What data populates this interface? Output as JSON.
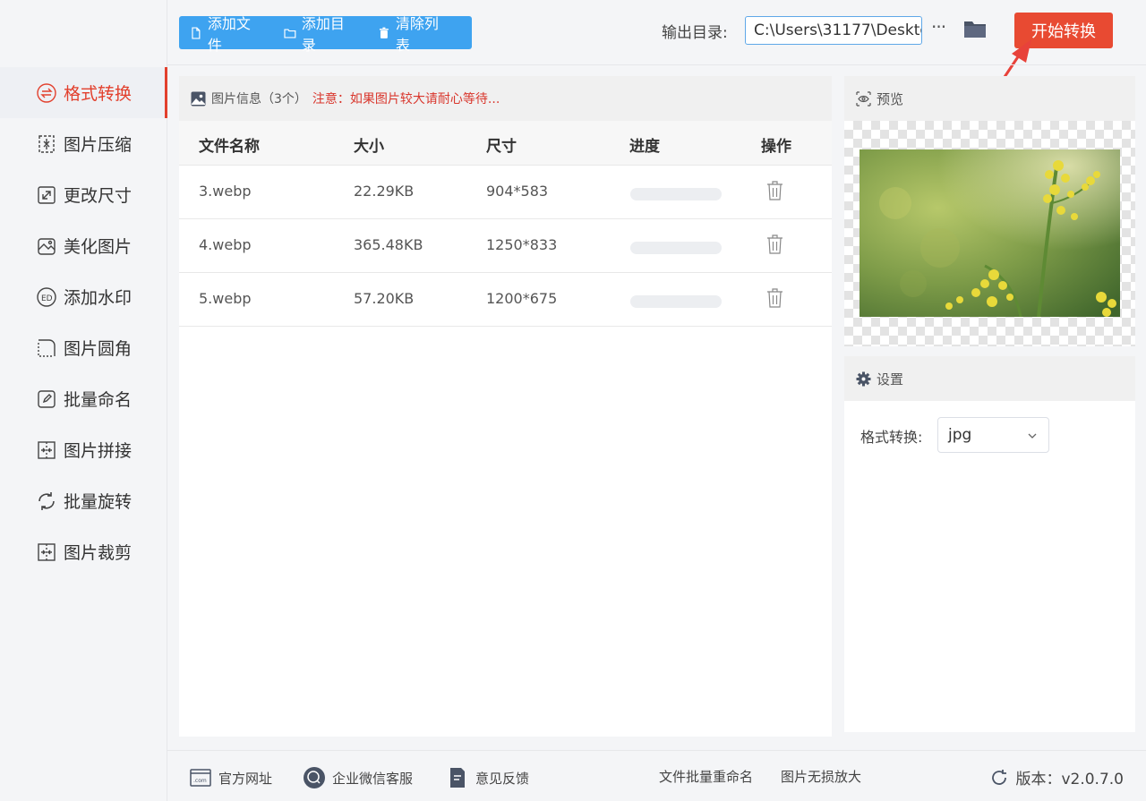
{
  "sidebar": {
    "items": [
      {
        "label": "格式转换",
        "icon": "swap-circle-icon",
        "active": true
      },
      {
        "label": "图片压缩",
        "icon": "compress-icon",
        "active": false
      },
      {
        "label": "更改尺寸",
        "icon": "resize-icon",
        "active": false
      },
      {
        "label": "美化图片",
        "icon": "beautify-icon",
        "active": false
      },
      {
        "label": "添加水印",
        "icon": "watermark-icon",
        "active": false
      },
      {
        "label": "图片圆角",
        "icon": "round-corner-icon",
        "active": false
      },
      {
        "label": "批量命名",
        "icon": "rename-icon",
        "active": false
      },
      {
        "label": "图片拼接",
        "icon": "merge-icon",
        "active": false
      },
      {
        "label": "批量旋转",
        "icon": "rotate-icon",
        "active": false
      },
      {
        "label": "图片裁剪",
        "icon": "crop-icon",
        "active": false
      }
    ]
  },
  "toolbar": {
    "add_file": "添加文件",
    "add_dir": "添加目录",
    "clear_list": "清除列表"
  },
  "output": {
    "label": "输出目录:",
    "path": "C:\\Users\\31177\\Deskto",
    "more": "···",
    "start": "开始转换"
  },
  "file_panel": {
    "title": "图片信息（3个）",
    "warning": "注意：如果图片较大请耐心等待...",
    "columns": [
      "文件名称",
      "大小",
      "尺寸",
      "进度",
      "操作"
    ],
    "rows": [
      {
        "name": "3.webp",
        "size": "22.29KB",
        "dim": "904*583",
        "progress": 0
      },
      {
        "name": "4.webp",
        "size": "365.48KB",
        "dim": "1250*833",
        "progress": 0
      },
      {
        "name": "5.webp",
        "size": "57.20KB",
        "dim": "1200*675",
        "progress": 0
      }
    ]
  },
  "preview": {
    "title": "预览"
  },
  "settings": {
    "title": "设置",
    "format_label": "格式转换:",
    "format_value": "jpg"
  },
  "footer": {
    "website": "官方网址",
    "wechat": "企业微信客服",
    "feedback": "意见反馈",
    "batch_rename": "文件批量重命名",
    "upscale": "图片无损放大",
    "version": "版本：v2.0.7.0"
  },
  "colors": {
    "accent": "#e84a32",
    "toolbar_blue": "#3ea3f0",
    "active_nav": "#e2402d"
  }
}
